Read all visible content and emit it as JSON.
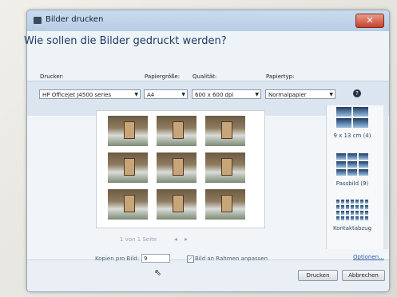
{
  "window": {
    "title": "Bilder drucken",
    "close_label": "✕"
  },
  "header": {
    "heading": "Wie sollen die Bilder gedruckt werden?"
  },
  "fields": {
    "printer": {
      "label": "Drucker:",
      "value": "HP Officejet J4500 series"
    },
    "paper_size": {
      "label": "Papiergröße:",
      "value": "A4"
    },
    "quality": {
      "label": "Qualität:",
      "value": "600 x 600 dpi"
    },
    "paper_type": {
      "label": "Papiertyp:",
      "value": "Normalpapier"
    },
    "help": "?"
  },
  "preview": {
    "page_text": "1 von 1 Seite",
    "prev": "◂",
    "next": "▸"
  },
  "layouts": [
    {
      "label": "9 x 13 cm (4)"
    },
    {
      "label": "Passbild (9)"
    },
    {
      "label": "Kontaktabzug"
    }
  ],
  "footer": {
    "copies_label": "Kopien pro Bild:",
    "copies_value": "9",
    "fit_label": "Bild an Rahmen anpassen",
    "options_link": "Optionen...",
    "print_button": "Drucken",
    "cancel_button": "Abbrechen"
  }
}
